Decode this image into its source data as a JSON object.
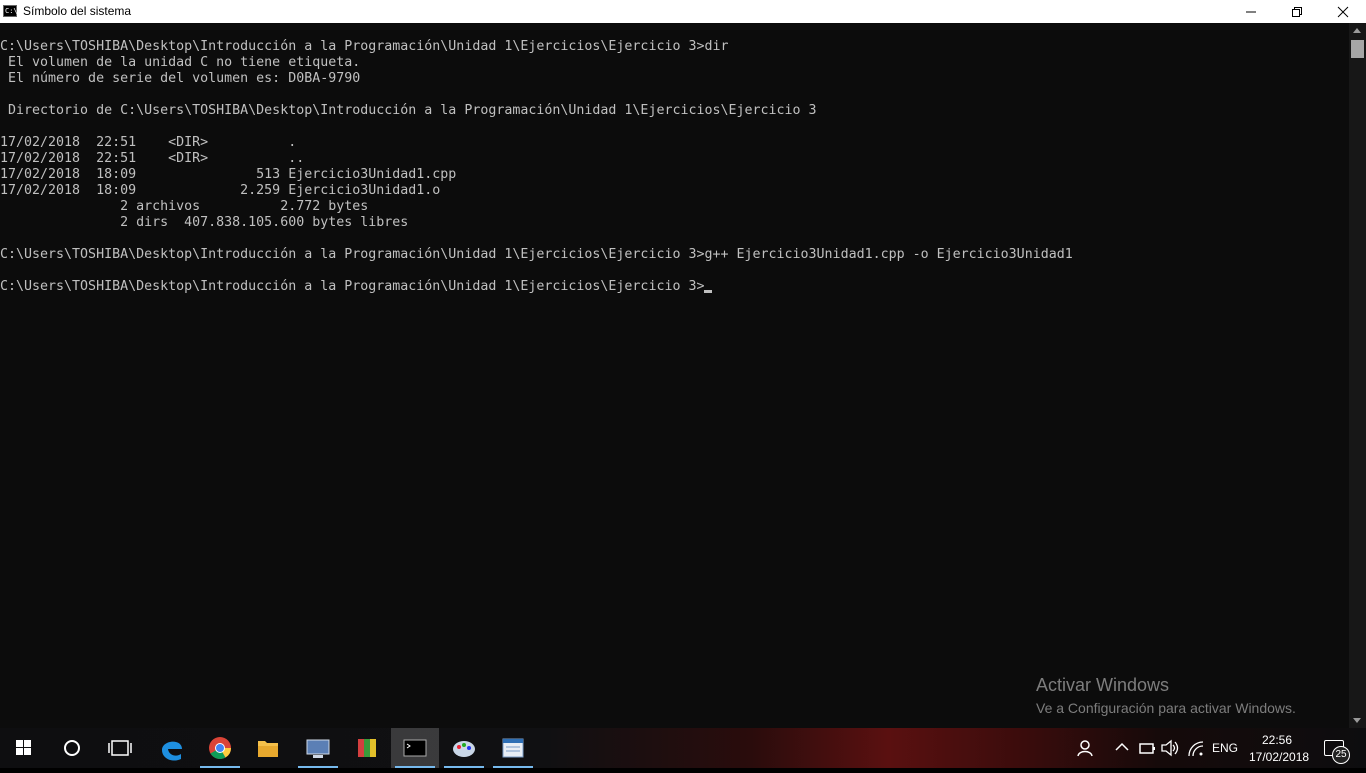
{
  "window": {
    "title": "Símbolo del sistema",
    "app_icon_text": "C:\\"
  },
  "console": {
    "lines": [
      "C:\\Users\\TOSHIBA\\Desktop\\Introducción a la Programación\\Unidad 1\\Ejercicios\\Ejercicio 3>dir",
      " El volumen de la unidad C no tiene etiqueta.",
      " El número de serie del volumen es: D0BA-9790",
      "",
      " Directorio de C:\\Users\\TOSHIBA\\Desktop\\Introducción a la Programación\\Unidad 1\\Ejercicios\\Ejercicio 3",
      "",
      "17/02/2018  22:51    <DIR>          .",
      "17/02/2018  22:51    <DIR>          ..",
      "17/02/2018  18:09               513 Ejercicio3Unidad1.cpp",
      "17/02/2018  18:09             2.259 Ejercicio3Unidad1.o",
      "               2 archivos          2.772 bytes",
      "               2 dirs  407.838.105.600 bytes libres",
      "",
      "C:\\Users\\TOSHIBA\\Desktop\\Introducción a la Programación\\Unidad 1\\Ejercicios\\Ejercicio 3>g++ Ejercicio3Unidad1.cpp -o Ejercicio3Unidad1",
      ""
    ],
    "prompt": "C:\\Users\\TOSHIBA\\Desktop\\Introducción a la Programación\\Unidad 1\\Ejercicios\\Ejercicio 3>"
  },
  "watermark": {
    "title": "Activar Windows",
    "subtitle": "Ve a Configuración para activar Windows."
  },
  "taskbar": {
    "apps": [
      {
        "name": "start-button",
        "icon": "windows-logo-icon"
      },
      {
        "name": "search-button",
        "icon": "cortana-circle-icon"
      },
      {
        "name": "task-view-button",
        "icon": "task-view-icon"
      },
      {
        "name": "edge",
        "icon": "edge-icon"
      },
      {
        "name": "chrome",
        "icon": "chrome-icon"
      },
      {
        "name": "file-explorer",
        "icon": "folder-icon"
      },
      {
        "name": "network-app",
        "icon": "computer-icon"
      },
      {
        "name": "winrar",
        "icon": "winrar-icon"
      },
      {
        "name": "command-prompt",
        "icon": "cmd-icon"
      },
      {
        "name": "paint",
        "icon": "paint-icon"
      },
      {
        "name": "notepad-app",
        "icon": "notepad-icon"
      }
    ],
    "tray": {
      "language": "ENG",
      "time": "22:56",
      "date": "17/02/2018",
      "notification_count": "25"
    }
  },
  "colors": {
    "console_bg": "#0c0c0c",
    "console_fg": "#c0c0c0",
    "accent": "#76b9ed"
  }
}
